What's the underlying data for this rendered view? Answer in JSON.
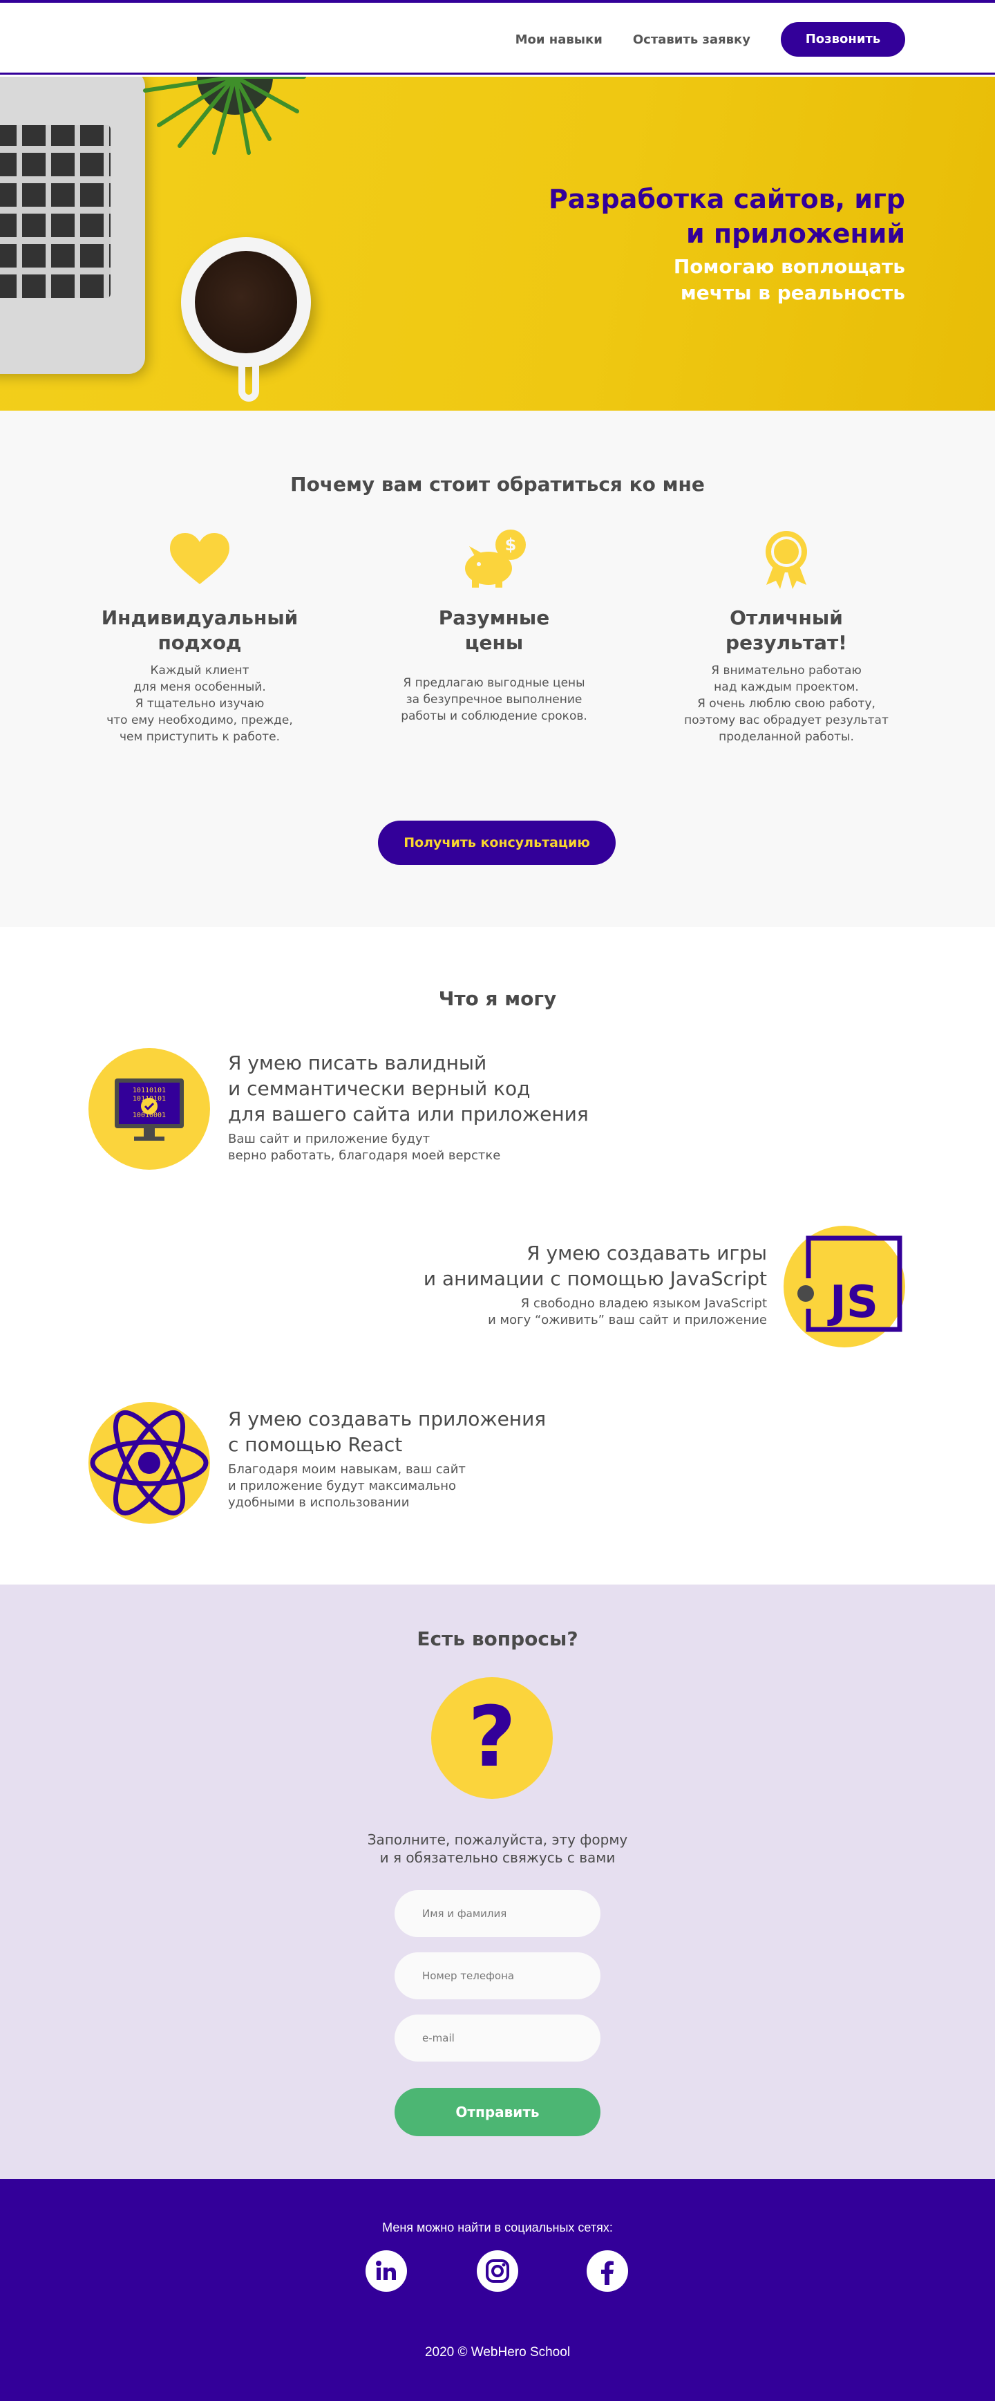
{
  "header": {
    "nav": [
      "Мои навыки",
      "Оставить заявку"
    ],
    "call_button": "Позвонить"
  },
  "hero": {
    "title_line1": "Разработка сайтов, игр",
    "title_line2": "и приложений",
    "subtitle_line1": "Помогаю воплощать",
    "subtitle_line2": "мечты в реальность"
  },
  "why": {
    "title": "Почему вам стоит обратиться ко мне",
    "features": [
      {
        "icon": "heart-icon",
        "title_line1": "Индивидуальный",
        "title_line2": "подход",
        "text": [
          "Каждый клиент",
          "для меня особенный.",
          "Я тщательно изучаю",
          "что ему необходимо, прежде,",
          "чем приступить к работе."
        ]
      },
      {
        "icon": "piggy-bank-icon",
        "title_line1": "Разумные",
        "title_line2": "цены",
        "text": [
          "Я предлагаю выгодные цены",
          "за безупречное выполнение",
          "работы и соблюдение сроков."
        ]
      },
      {
        "icon": "award-icon",
        "title_line1": "Отличный",
        "title_line2": "результат!",
        "text": [
          "Я внимательно работаю",
          "над каждым проектом.",
          "Я очень люблю свою работу,",
          "поэтому вас обрадует результат",
          "проделанной работы."
        ]
      }
    ],
    "button": "Получить консультацию"
  },
  "skills": {
    "title": "Что я могу",
    "items": [
      {
        "icon": "monitor-code-icon",
        "title": [
          "Я умею писать валидный",
          "и семмантически верный код",
          "для вашего сайта или приложения"
        ],
        "text": [
          "Ваш сайт и приложение будут",
          "верно работать, благодаря моей верстке"
        ]
      },
      {
        "icon": "javascript-icon",
        "title": [
          "Я умею создавать игры",
          "и анимации с помощью JavaScript"
        ],
        "text": [
          "Я свободно владею языком JavaScript",
          "и могу “оживить” ваш сайт и приложение"
        ]
      },
      {
        "icon": "react-icon",
        "title": [
          "Я умею создавать приложения",
          "с помощью React"
        ],
        "text": [
          "Благодаря моим навыкам, ваш сайт",
          "и приложение будут максимально",
          "удобными в использовании"
        ]
      }
    ],
    "monitor_binary": [
      "10110101",
      "10110101",
      "10010001"
    ],
    "js_label": "JS"
  },
  "questions": {
    "title": "Есть вопросы?",
    "mark": "?",
    "text_line1": "Заполните, пожалуйста, эту форму",
    "text_line2": "и я обязательно свяжусь с вами",
    "name_placeholder": "Имя и фамилия",
    "phone_placeholder": "Номер телефона",
    "email_placeholder": "e-mail",
    "submit": "Отправить"
  },
  "footer": {
    "social_text": "Меня можно найти в социальных сетях:",
    "social_icons": [
      "linkedin-icon",
      "instagram-icon",
      "facebook-icon"
    ],
    "copyright": "2020  ©  WebHero School"
  },
  "colors": {
    "primary": "#330099",
    "yellow": "#fbd43c",
    "green": "#4cb673",
    "lavender": "#e6dff0"
  }
}
